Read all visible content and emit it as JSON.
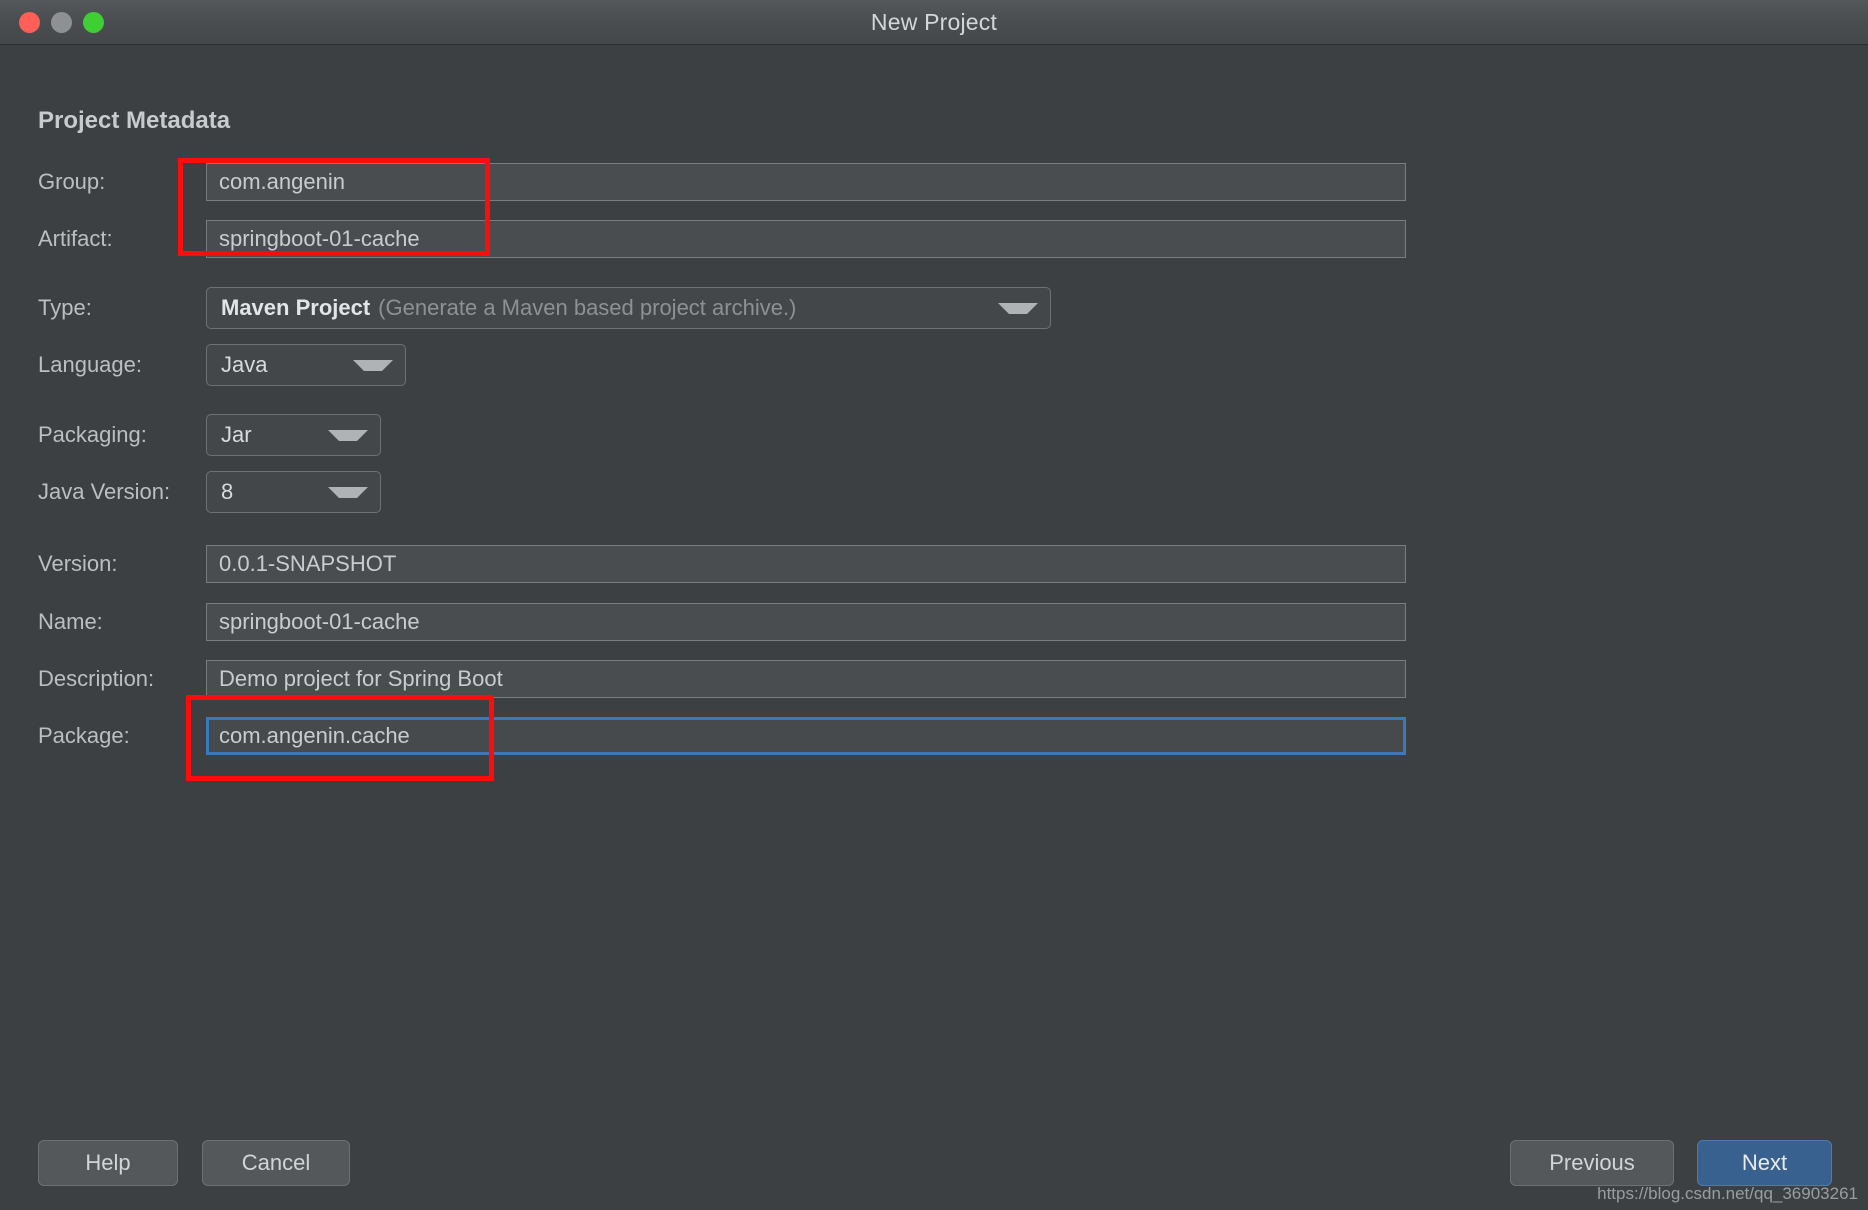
{
  "window": {
    "title": "New Project",
    "traffic_lights": [
      {
        "name": "close",
        "color": "#ff5f57"
      },
      {
        "name": "minimize",
        "color": "#8e9094"
      },
      {
        "name": "maximize",
        "color": "#3fcf35"
      }
    ]
  },
  "section": {
    "heading": "Project Metadata"
  },
  "fields": {
    "group": {
      "label": "Group:",
      "value": "com.angenin"
    },
    "artifact": {
      "label": "Artifact:",
      "value": "springboot-01-cache"
    },
    "type": {
      "label": "Type:",
      "value": "Maven Project",
      "hint": "(Generate a Maven based project archive.)"
    },
    "language": {
      "label": "Language:",
      "value": "Java"
    },
    "packaging": {
      "label": "Packaging:",
      "value": "Jar"
    },
    "java_version": {
      "label": "Java Version:",
      "value": "8"
    },
    "version": {
      "label": "Version:",
      "value": "0.0.1-SNAPSHOT"
    },
    "name": {
      "label": "Name:",
      "value": "springboot-01-cache"
    },
    "description": {
      "label": "Description:",
      "value": "Demo project for Spring Boot"
    },
    "package": {
      "label": "Package:",
      "value": "com.angenin.cache",
      "focused": true
    }
  },
  "buttons": {
    "help": "Help",
    "cancel": "Cancel",
    "previous": "Previous",
    "next": "Next"
  },
  "annotations": {
    "accent_color": "#fb0d0d",
    "focus_color": "#3d79b8"
  },
  "watermark": "https://blog.csdn.net/qq_36903261"
}
